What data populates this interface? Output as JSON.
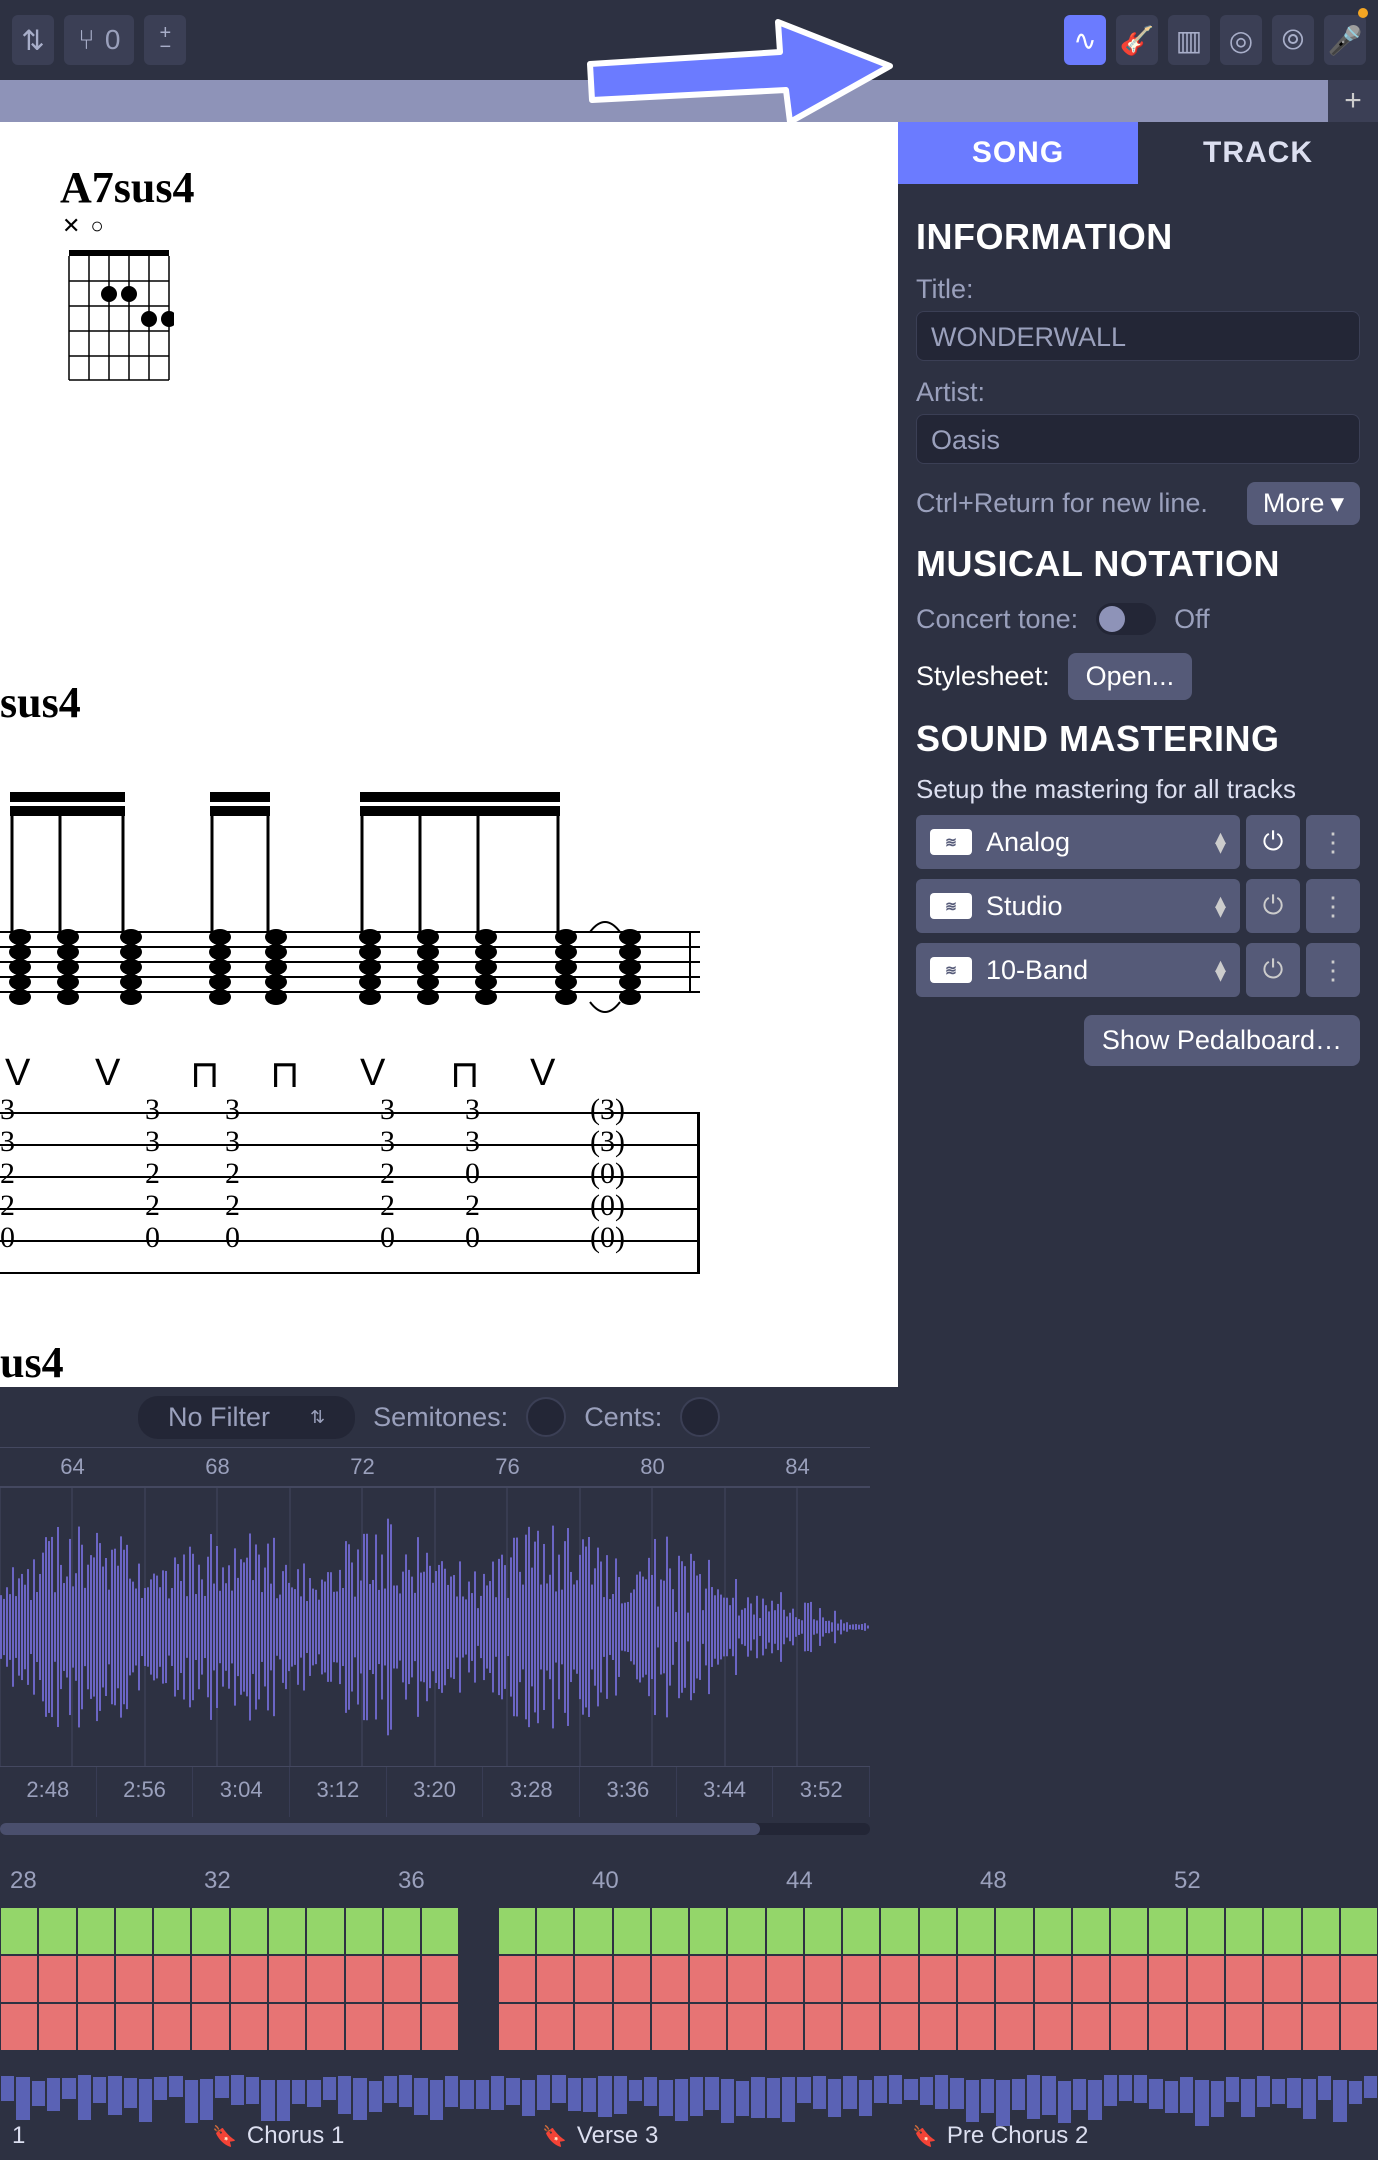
{
  "toolbar": {
    "counter": "0",
    "groups": [
      "waveform",
      "guitar",
      "piano",
      "drums",
      "broadcast",
      "mic"
    ]
  },
  "tabs": {
    "song": "SONG",
    "track": "TRACK"
  },
  "info": {
    "heading": "INFORMATION",
    "title_label": "Title:",
    "title_value": "WONDERWALL",
    "artist_label": "Artist:",
    "artist_value": "Oasis",
    "newline_hint": "Ctrl+Return for new line.",
    "more": "More"
  },
  "notation": {
    "heading": "MUSICAL NOTATION",
    "concert_label": "Concert tone:",
    "concert_state": "Off",
    "stylesheet_label": "Stylesheet:",
    "open": "Open..."
  },
  "mastering": {
    "heading": "SOUND MASTERING",
    "subtitle": "Setup the mastering for all tracks",
    "rows": [
      {
        "label": "Analog",
        "power": true
      },
      {
        "label": "Studio",
        "power": false
      },
      {
        "label": "10-Band",
        "power": false
      }
    ],
    "pedalboard": "Show Pedalboard…"
  },
  "score": {
    "chord": "A7sus4",
    "chord_markers": "✕○",
    "section_label": "sus4",
    "section_label2": "us4",
    "tab_columns": [
      [
        "3",
        "3",
        "2",
        "2",
        "0"
      ],
      [
        "3",
        "3",
        "2",
        "2",
        "0"
      ],
      [
        "3",
        "3",
        "2",
        "2",
        "0"
      ],
      [
        "3",
        "3",
        "2",
        "2",
        "0"
      ],
      [
        "3",
        "3",
        "0",
        "2",
        "0"
      ],
      [
        "(3)",
        "(3)",
        "(0)",
        "(0)",
        "(0)"
      ]
    ],
    "strum": [
      "V",
      "V",
      "⊓",
      "⊓",
      "V",
      "⊓",
      "V"
    ]
  },
  "audio": {
    "filter": "No Filter",
    "semitones_label": "Semitones:",
    "cents_label": "Cents:",
    "bar_ticks": [
      "64",
      "68",
      "72",
      "76",
      "80",
      "84"
    ],
    "time_ticks": [
      "2:48",
      "2:56",
      "3:04",
      "3:12",
      "3:20",
      "3:28",
      "3:36",
      "3:44",
      "3:52"
    ]
  },
  "timeline": {
    "bars": [
      "28",
      "32",
      "36",
      "40",
      "44",
      "48",
      "52"
    ],
    "sections": [
      " 1",
      "Chorus 1",
      "Verse 3",
      "Pre Chorus 2"
    ]
  }
}
